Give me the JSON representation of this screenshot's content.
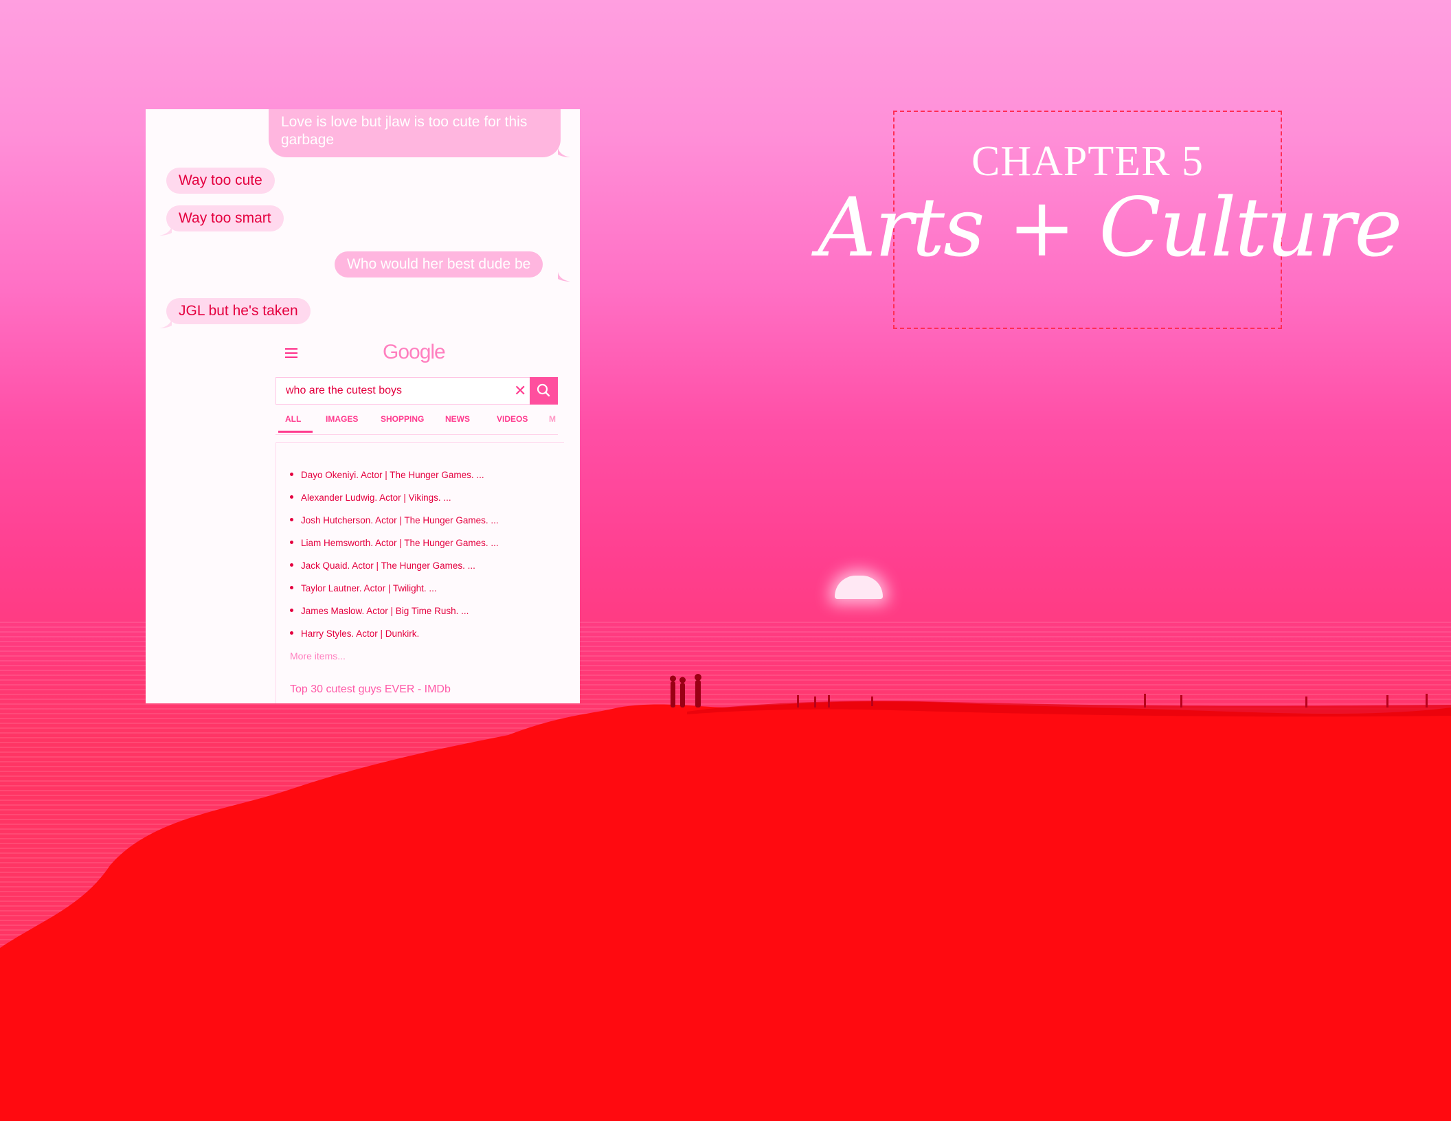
{
  "chapter": {
    "number_label": "CHAPTER 5",
    "title": "Arts + Culture"
  },
  "messages": [
    {
      "direction": "outgoing",
      "text": "Love is love but jlaw is too cute for this garbage"
    },
    {
      "direction": "incoming",
      "text": "Way too cute"
    },
    {
      "direction": "incoming",
      "text": "Way too smart"
    },
    {
      "direction": "outgoing",
      "text": "Who would her best dude be"
    },
    {
      "direction": "incoming",
      "text": "JGL but he's taken"
    }
  ],
  "google": {
    "logo": "Google",
    "query": "who are the cutest boys",
    "tabs": [
      "ALL",
      "IMAGES",
      "SHOPPING",
      "NEWS",
      "VIDEOS",
      "M"
    ],
    "active_tab": "ALL",
    "results": [
      "Dayo Okeniyi. Actor | The Hunger Games. ...",
      "Alexander Ludwig. Actor | Vikings. ...",
      "Josh Hutcherson. Actor | The Hunger Games. ...",
      "Liam Hemsworth. Actor | The Hunger Games. ...",
      "Jack Quaid. Actor | The Hunger Games. ...",
      "Taylor Lautner. Actor | Twilight. ...",
      "James Maslow. Actor | Big Time Rush. ...",
      "Harry Styles. Actor | Dunkirk."
    ],
    "more_items": "More items...",
    "source_link": "Top 30 cutest guys EVER - IMDb"
  },
  "colors": {
    "accent": "#ff3a8e",
    "text_red": "#e4003f",
    "sky_top": "#ff9fe0",
    "land": "#ff0a0f"
  },
  "icons": [
    "hamburger-menu-icon",
    "clear-icon",
    "search-icon"
  ]
}
